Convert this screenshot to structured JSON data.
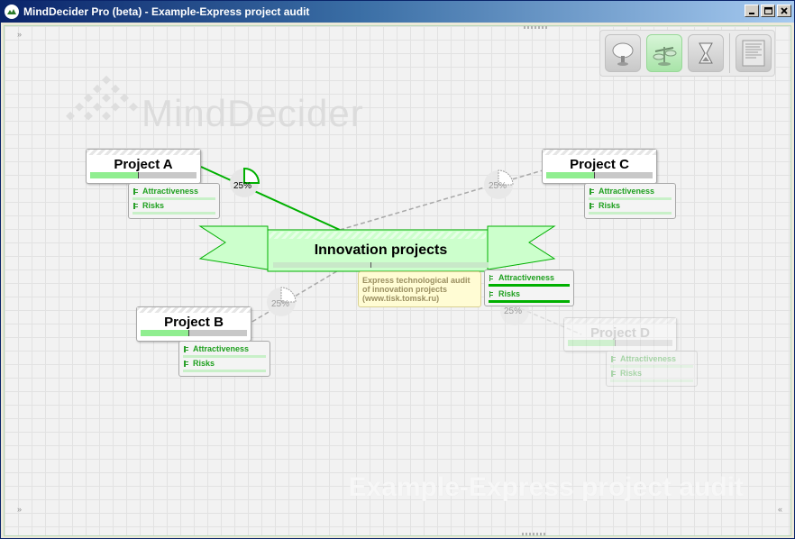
{
  "window": {
    "title": "MindDecider Pro (beta) - Example-Express project audit",
    "controls": {
      "minimize": "_",
      "maximize": "□",
      "close": "✕"
    }
  },
  "watermark": {
    "brand": "MindDecider",
    "project_title": "Example-Express project audit"
  },
  "toolbar": {
    "buttons": [
      {
        "icon": "brainstorm-cloud-icon",
        "active": false
      },
      {
        "icon": "decision-scales-icon",
        "active": true
      },
      {
        "icon": "hourglass-icon",
        "active": false
      },
      {
        "icon": "report-document-icon",
        "active": false
      }
    ]
  },
  "canvas": {
    "corner_expand": "»",
    "corner_collapse": "«"
  },
  "main_node": {
    "label": "Innovation projects",
    "note": "Express technological audit of innovation projects (www.tisk.tomsk.ru)",
    "criteria": [
      "Attractiveness",
      "Risks"
    ]
  },
  "projects": [
    {
      "label": "Project A",
      "weight": "25%",
      "criteria": [
        "Attractiveness",
        "Risks"
      ],
      "score": 0.45,
      "faded": false
    },
    {
      "label": "Project B",
      "weight": "25%",
      "criteria": [
        "Attractiveness",
        "Risks"
      ],
      "score": 0.45,
      "faded": false
    },
    {
      "label": "Project C",
      "weight": "25%",
      "criteria": [
        "Attractiveness",
        "Risks"
      ],
      "score": 0.45,
      "faded": false
    },
    {
      "label": "Project D",
      "weight": "25%",
      "criteria": [
        "Attractiveness",
        "Risks"
      ],
      "score": 0.45,
      "faded": true
    }
  ],
  "colors": {
    "accent_green": "#00b000",
    "light_green": "#90ee90",
    "title_bar": "#0a246a",
    "note_bg": "#fffcd4"
  }
}
